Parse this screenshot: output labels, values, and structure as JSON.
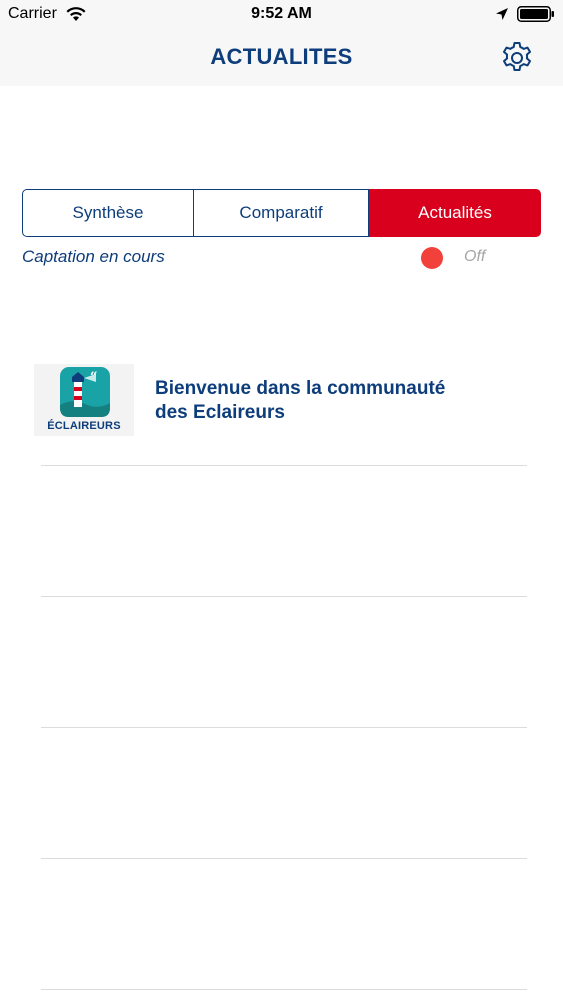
{
  "status_bar": {
    "carrier": "Carrier",
    "time": "9:52 AM"
  },
  "nav": {
    "title": "ACTUALITES",
    "settings_icon": "gear-icon"
  },
  "tabs": [
    {
      "label": "Synthèse",
      "selected": false
    },
    {
      "label": "Comparatif",
      "selected": false
    },
    {
      "label": "Actualités",
      "selected": true
    }
  ],
  "capture": {
    "label": "Captation en cours",
    "status": "Off",
    "indicator_color": "#f2403a"
  },
  "news": [
    {
      "logo_text": "ÉCLAIREURS",
      "title_line1": "Bienvenue dans la communauté",
      "title_line2": "des Eclaireurs"
    }
  ],
  "colors": {
    "brand_blue": "#0d3d7a",
    "accent_red": "#d8001c"
  }
}
